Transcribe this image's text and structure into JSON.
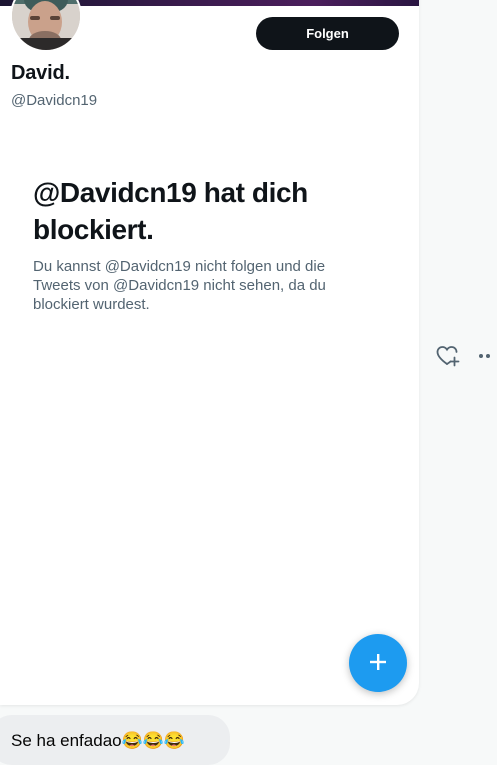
{
  "profile": {
    "name": "David.",
    "handle": "@Davidcn19",
    "follow_label": "Folgen"
  },
  "blocked": {
    "title": "@Davidcn19 hat dich blockiert.",
    "description": "Du kannst @Davidcn19 nicht folgen und die Tweets von @Davidcn19 nicht sehen, da du blockiert wurdest."
  },
  "fab": {
    "icon": "plus-icon"
  },
  "side_actions": {
    "icons": [
      "heart-plus-icon",
      "more-dots-icon"
    ]
  },
  "comment": {
    "text": "Se ha enfadao😂😂😂"
  },
  "colors": {
    "accent": "#1d9bf0",
    "follow_button": "#0f1419",
    "secondary_text": "#536471",
    "comment_bubble": "#eceef0"
  }
}
